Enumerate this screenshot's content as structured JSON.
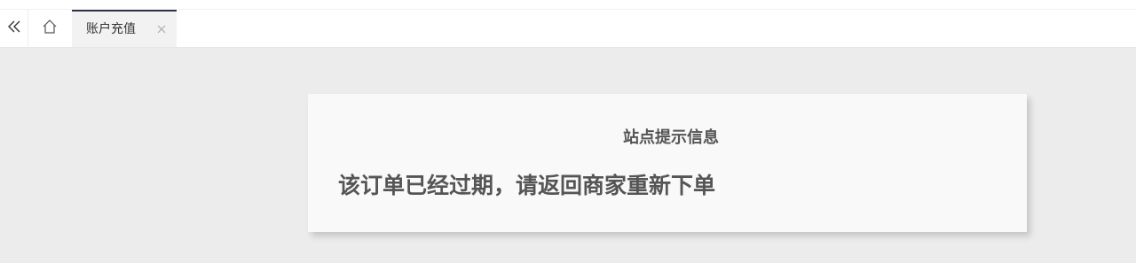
{
  "tabs": [
    {
      "label": "账户充值",
      "active": true
    }
  ],
  "notice": {
    "title": "站点提示信息",
    "message": "该订单已经过期，请返回商家重新下单"
  },
  "colors": {
    "page_bg": "#ececec",
    "tab_active_border": "#2f3549",
    "text": "#555555"
  }
}
